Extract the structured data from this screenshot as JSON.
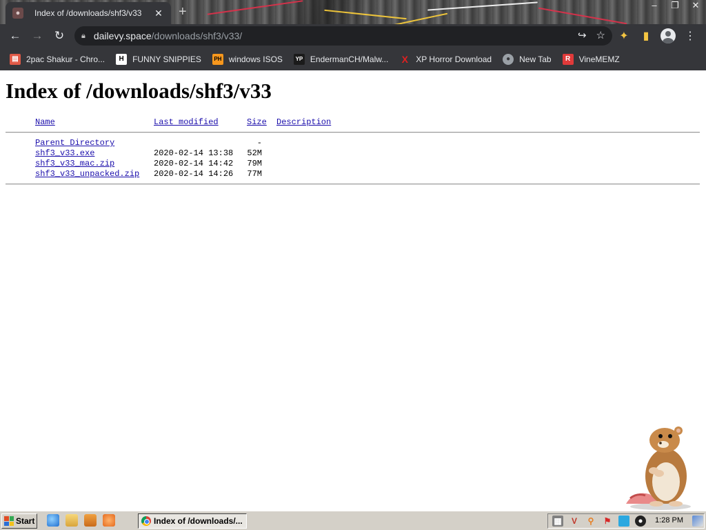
{
  "browser": {
    "tab": {
      "title": "Index of /downloads/shf3/v33"
    },
    "url": {
      "host": "dailevy.space",
      "path": "/downloads/shf3/v33/"
    },
    "bookmarks": [
      {
        "label": "2pac Shakur - Chro...",
        "icon": "archive-icon",
        "color": "#e05a47"
      },
      {
        "label": "FUNNY SNIPPIES",
        "icon": "H",
        "color": "#ffffff"
      },
      {
        "label": "windows ISOS",
        "icon": "PH",
        "color": "#f7971d"
      },
      {
        "label": "EndermanCH/Malw...",
        "icon": "YP",
        "color": "#1b1b1b"
      },
      {
        "label": "XP Horror Download",
        "icon": "X",
        "color": "#e02020"
      },
      {
        "label": "New Tab",
        "icon": "globe-icon",
        "color": "#9aa0a6"
      },
      {
        "label": "VineMEMZ",
        "icon": "R",
        "color": "#e03a3a"
      }
    ]
  },
  "page": {
    "heading": "Index of /downloads/shf3/v33",
    "columns": {
      "name": "Name",
      "modified": "Last modified",
      "size": "Size",
      "description": "Description"
    },
    "rows": [
      {
        "name": "Parent Directory",
        "modified": "",
        "size": "-"
      },
      {
        "name": "shf3_v33.exe",
        "modified": "2020-02-14 13:38",
        "size": "52M"
      },
      {
        "name": "shf3_v33_mac.zip",
        "modified": "2020-02-14 14:42",
        "size": "79M"
      },
      {
        "name": "shf3_v33_unpacked.zip",
        "modified": "2020-02-14 14:26",
        "size": "77M"
      }
    ]
  },
  "taskbar": {
    "start_label": "Start",
    "task_label": "Index of /downloads/...",
    "clock": "1:28 PM"
  },
  "colors": {
    "link": "#1a0dab",
    "chrome_dark": "#35363a",
    "taskbar": "#d4d0c8"
  }
}
